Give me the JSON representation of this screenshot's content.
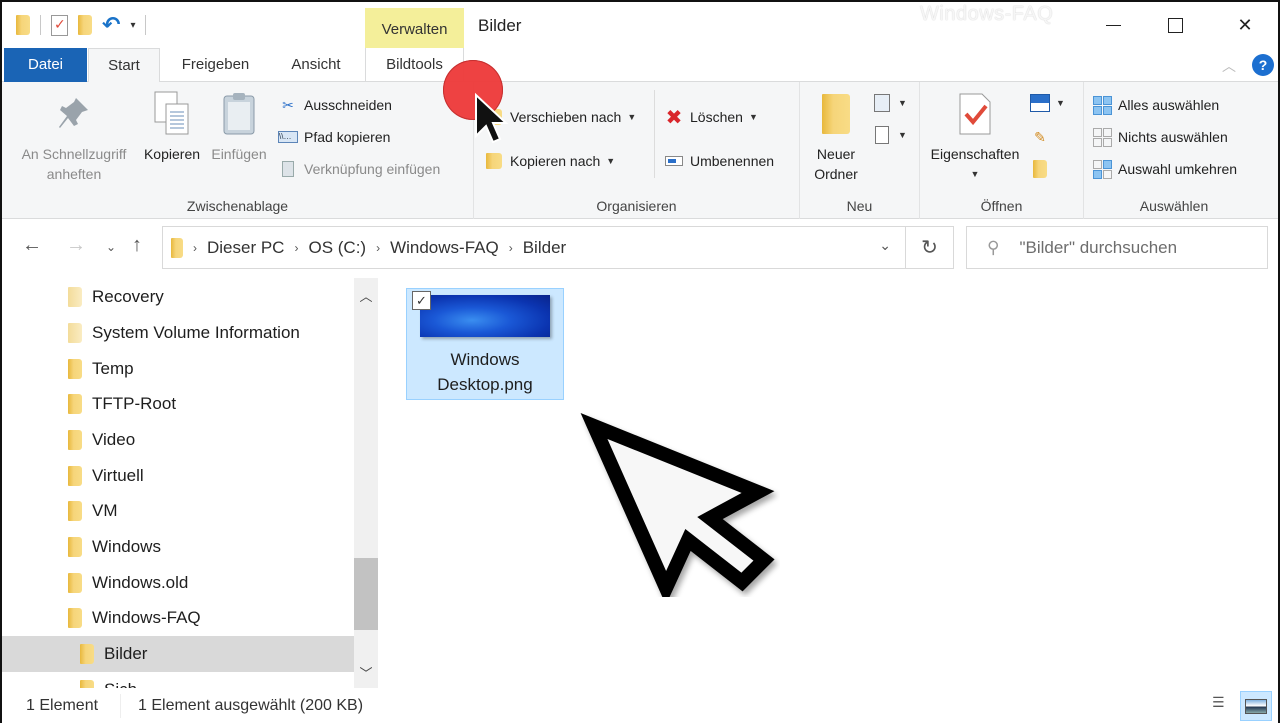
{
  "window": {
    "title": "Bilder",
    "context_tab_group": "Verwalten",
    "watermark": "Windows-FAQ",
    "controls": {
      "minimize": "minimize-icon",
      "maximize": "maximize-icon",
      "close": "close-icon"
    }
  },
  "quick_access_toolbar": {
    "icons": [
      "folder-icon",
      "properties-icon",
      "new-folder-icon",
      "undo-icon",
      "customize-dropdown-icon"
    ]
  },
  "tabs": [
    {
      "label": "Datei",
      "active": false
    },
    {
      "label": "Start",
      "active": true
    },
    {
      "label": "Freigeben",
      "active": false
    },
    {
      "label": "Ansicht",
      "active": false
    },
    {
      "label": "Bildtools",
      "active": false
    }
  ],
  "ribbon": {
    "clipboard": {
      "label": "Zwischenablage",
      "pin_label_1": "An Schnellzugriff",
      "pin_label_2": "anheften",
      "copy_label": "Kopieren",
      "paste_label": "Einfügen",
      "cut_label": "Ausschneiden",
      "copy_path_label": "Pfad kopieren",
      "paste_shortcut_label": "Verknüpfung einfügen"
    },
    "organize": {
      "label": "Organisieren",
      "move_to_label": "Verschieben nach",
      "copy_to_label": "Kopieren nach",
      "delete_label": "Löschen",
      "rename_label": "Umbenennen"
    },
    "new": {
      "label": "Neu",
      "new_folder_label_1": "Neuer",
      "new_folder_label_2": "Ordner"
    },
    "open": {
      "label": "Öffnen",
      "properties_label": "Eigenschaften"
    },
    "select": {
      "label": "Auswählen",
      "select_all_label": "Alles auswählen",
      "select_none_label": "Nichts auswählen",
      "invert_selection_label": "Auswahl umkehren"
    }
  },
  "address_bar": {
    "breadcrumbs": [
      "Dieser PC",
      "OS (C:)",
      "Windows-FAQ",
      "Bilder"
    ],
    "search_placeholder": "\"Bilder\" durchsuchen"
  },
  "nav_pane": {
    "items": [
      {
        "label": "Recovery",
        "hidden": true
      },
      {
        "label": "System Volume Information",
        "hidden": true
      },
      {
        "label": "Temp"
      },
      {
        "label": "TFTP-Root"
      },
      {
        "label": "Video"
      },
      {
        "label": "Virtuell"
      },
      {
        "label": "VM"
      },
      {
        "label": "Windows"
      },
      {
        "label": "Windows.old"
      },
      {
        "label": "Windows-FAQ"
      },
      {
        "label": "Bilder",
        "selected": true,
        "child": true
      },
      {
        "label": "Sich",
        "child": true,
        "partial": true
      }
    ]
  },
  "content": {
    "files": [
      {
        "name_line1": "Windows",
        "name_line2": "Desktop.png",
        "selected": true,
        "checked": true
      }
    ]
  },
  "status_bar": {
    "item_count": "1 Element",
    "selection": "1 Element ausgewählt (200 KB)"
  },
  "colors": {
    "file_tab": "#1a64b5",
    "context_tab": "#f4ef9a",
    "selection_bg": "#cce8ff",
    "click_indicator": "#ee3b3b",
    "help": "#1c6fd0"
  }
}
